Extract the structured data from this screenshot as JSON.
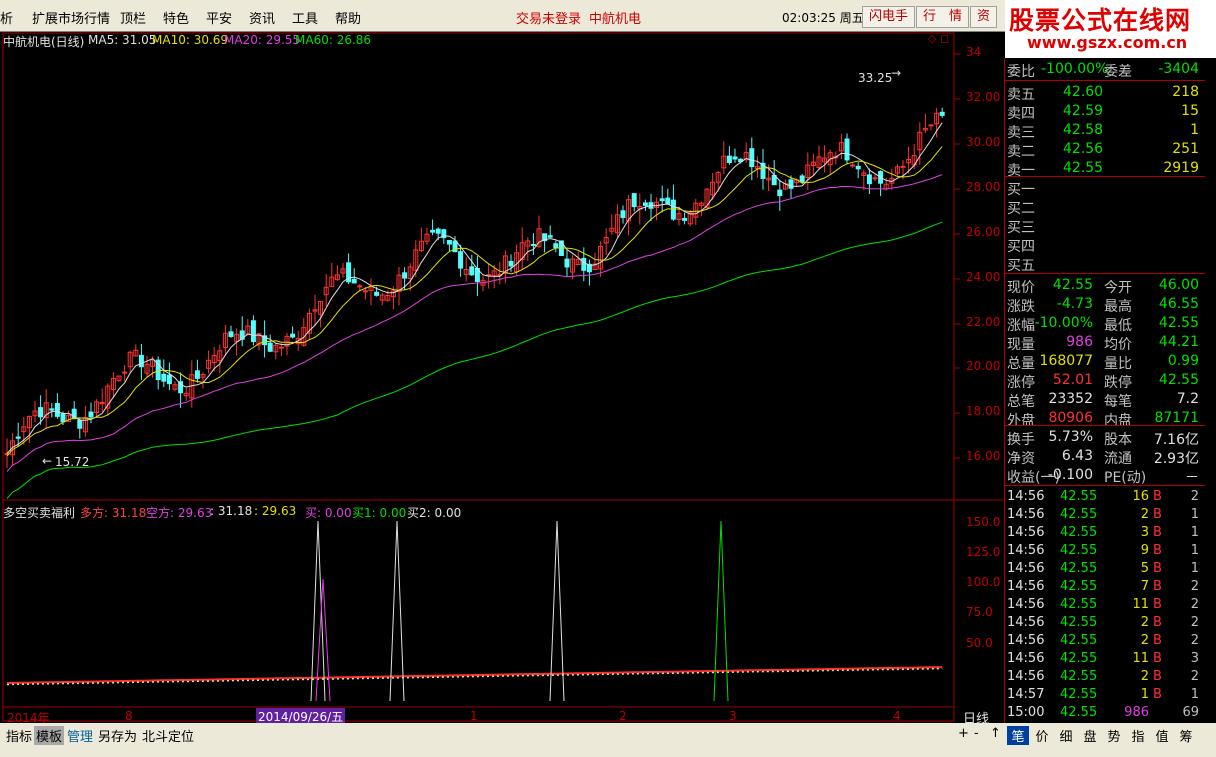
{
  "menu": {
    "items": [
      "析",
      "扩展市场行情",
      "顶栏",
      "特色",
      "平安",
      "资讯",
      "工具",
      "帮助"
    ],
    "status_login": "交易未登录",
    "status_stock": "中航机电",
    "clock": "02:03:25 周五",
    "btn_flash": "闪电手",
    "btn_quote": "行　情",
    "btn_zi": "资"
  },
  "logo": {
    "title": "股票公式在线网",
    "url": "www.gszx.com.cn"
  },
  "main_chart": {
    "title": "中航机电(日线)",
    "ma5": "MA5: 31.05",
    "ma10": "MA10: 30.69",
    "ma20": "MA20: 29.55",
    "ma60": "MA60: 26.86",
    "high_label": "33.25",
    "low_label": "15.72",
    "y_ticks": [
      "34",
      "32.00",
      "30.00",
      "28.00",
      "26.00",
      "24.00",
      "22.00",
      "20.00",
      "18.00",
      "16.00"
    ]
  },
  "indicator": {
    "name": "多空买卖福利",
    "duo": "多方: 31.18",
    "kong": "空方: 29.63",
    "v1": ": 31.18",
    "v2": ": 29.63",
    "buy": "买: 0.00",
    "buy1": "买1: 0.00",
    "buy2": "买2: 0.00",
    "y_ticks": [
      "150.0",
      "125.0",
      "100.0",
      "75.0",
      "50.0"
    ]
  },
  "x_axis": {
    "labels": [
      "2014年",
      "8",
      "2014/09/26/五",
      "1",
      "2",
      "3",
      "4"
    ],
    "period": "日线"
  },
  "quote": {
    "weibi_label": "委比",
    "weibi": "-100.00%",
    "weicha_label": "委差",
    "weicha": "-3404",
    "sells": [
      {
        "label": "卖五",
        "price": "42.60",
        "vol": "218"
      },
      {
        "label": "卖四",
        "price": "42.59",
        "vol": "15"
      },
      {
        "label": "卖三",
        "price": "42.58",
        "vol": "1"
      },
      {
        "label": "卖二",
        "price": "42.56",
        "vol": "251"
      },
      {
        "label": "卖一",
        "price": "42.55",
        "vol": "2919"
      }
    ],
    "buys": [
      "买一",
      "买二",
      "买三",
      "买四",
      "买五"
    ],
    "stats": [
      {
        "l1": "现价",
        "v1": "42.55",
        "c1": "#00e000",
        "l2": "今开",
        "v2": "46.00",
        "c2": "#00e000"
      },
      {
        "l1": "涨跌",
        "v1": "-4.73",
        "c1": "#00e000",
        "l2": "最高",
        "v2": "46.55",
        "c2": "#00e000"
      },
      {
        "l1": "涨幅",
        "v1": "-10.00%",
        "c1": "#00e000",
        "l2": "最低",
        "v2": "42.55",
        "c2": "#00e000"
      },
      {
        "l1": "现量",
        "v1": "986",
        "c1": "#e040e0",
        "l2": "均价",
        "v2": "44.21",
        "c2": "#00e000"
      },
      {
        "l1": "总量",
        "v1": "168077",
        "c1": "#e0e000",
        "l2": "量比",
        "v2": "0.99",
        "c2": "#00e000"
      },
      {
        "l1": "涨停",
        "v1": "52.01",
        "c1": "#ff3030",
        "l2": "跌停",
        "v2": "42.55",
        "c2": "#00e000"
      },
      {
        "l1": "总笔",
        "v1": "23352",
        "c1": "#e0e0e0",
        "l2": "每笔",
        "v2": "7.2",
        "c2": "#e0e0e0"
      },
      {
        "l1": "外盘",
        "v1": "80906",
        "c1": "#ff3030",
        "l2": "内盘",
        "v2": "87171",
        "c2": "#00e000"
      }
    ],
    "fund": [
      {
        "l1": "换手",
        "v1": "5.73%",
        "l2": "股本",
        "v2": "7.16亿"
      },
      {
        "l1": "净资",
        "v1": "6.43",
        "l2": "流通",
        "v2": "2.93亿"
      },
      {
        "l1": "收益(一)",
        "v1": "-0.100",
        "l2": "PE(动)",
        "v2": "－"
      }
    ]
  },
  "ticks": [
    {
      "t": "14:56",
      "p": "42.55",
      "v": "16",
      "s": "B",
      "n": "2"
    },
    {
      "t": "14:56",
      "p": "42.55",
      "v": "2",
      "s": "B",
      "n": "1"
    },
    {
      "t": "14:56",
      "p": "42.55",
      "v": "3",
      "s": "B",
      "n": "1"
    },
    {
      "t": "14:56",
      "p": "42.55",
      "v": "9",
      "s": "B",
      "n": "1"
    },
    {
      "t": "14:56",
      "p": "42.55",
      "v": "5",
      "s": "B",
      "n": "1"
    },
    {
      "t": "14:56",
      "p": "42.55",
      "v": "7",
      "s": "B",
      "n": "2"
    },
    {
      "t": "14:56",
      "p": "42.55",
      "v": "11",
      "s": "B",
      "n": "2"
    },
    {
      "t": "14:56",
      "p": "42.55",
      "v": "2",
      "s": "B",
      "n": "2"
    },
    {
      "t": "14:56",
      "p": "42.55",
      "v": "2",
      "s": "B",
      "n": "2"
    },
    {
      "t": "14:56",
      "p": "42.55",
      "v": "11",
      "s": "B",
      "n": "3"
    },
    {
      "t": "14:56",
      "p": "42.55",
      "v": "2",
      "s": "B",
      "n": "2"
    },
    {
      "t": "14:57",
      "p": "42.55",
      "v": "1",
      "s": "B",
      "n": "1"
    },
    {
      "t": "15:00",
      "p": "42.55",
      "v": "986",
      "s": "",
      "n": "69"
    }
  ],
  "bottom": {
    "tabs": [
      "指标",
      "模板",
      "管理",
      "另存为",
      "北斗定位"
    ],
    "controls": [
      "+",
      "-",
      "↑",
      "↓"
    ],
    "right_tabs": [
      "笔",
      "价",
      "细",
      "盘",
      "势",
      "指",
      "值",
      "筹"
    ]
  }
}
